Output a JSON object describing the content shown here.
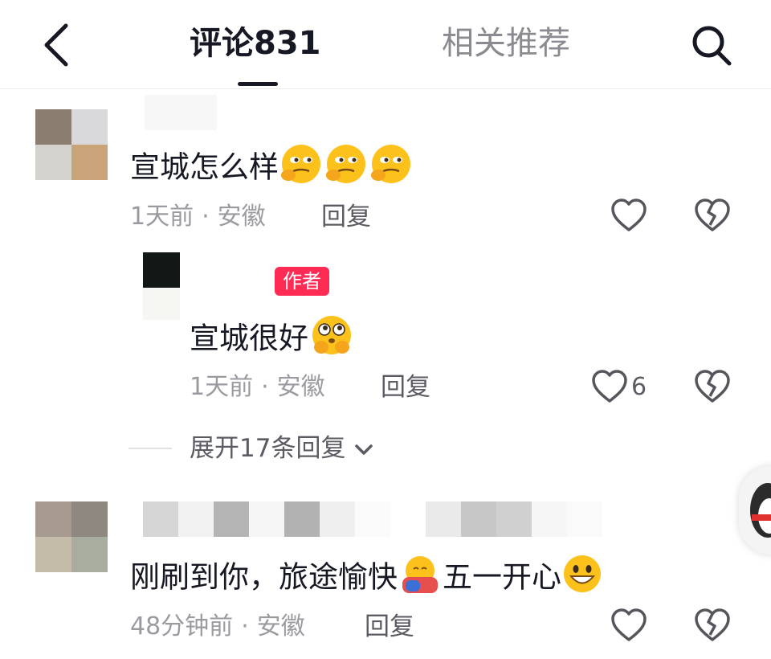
{
  "header": {
    "tab_comments": "评论831",
    "tab_related": "相关推荐"
  },
  "comments": [
    {
      "text": "宣城怎么样",
      "emoji": [
        "think-emoji",
        "think-emoji",
        "think-emoji"
      ],
      "time": "1天前",
      "location": "安徽",
      "reply_label": "回复",
      "replies": [
        {
          "badge": "作者",
          "text": "宣城很好",
          "emoji": [
            "shy-emoji"
          ],
          "time": "1天前",
          "location": "安徽",
          "reply_label": "回复",
          "like_count": "6"
        }
      ],
      "expand_label": "展开17条回复"
    },
    {
      "text_part1": "刚刷到你，旅途愉快",
      "text_part2": "五一开心",
      "time": "48分钟前",
      "location": "安徽",
      "reply_label": "回复"
    }
  ],
  "colors": {
    "accent": "#fe2c55",
    "text_primary": "#161823",
    "text_secondary": "#9a9ba0"
  }
}
